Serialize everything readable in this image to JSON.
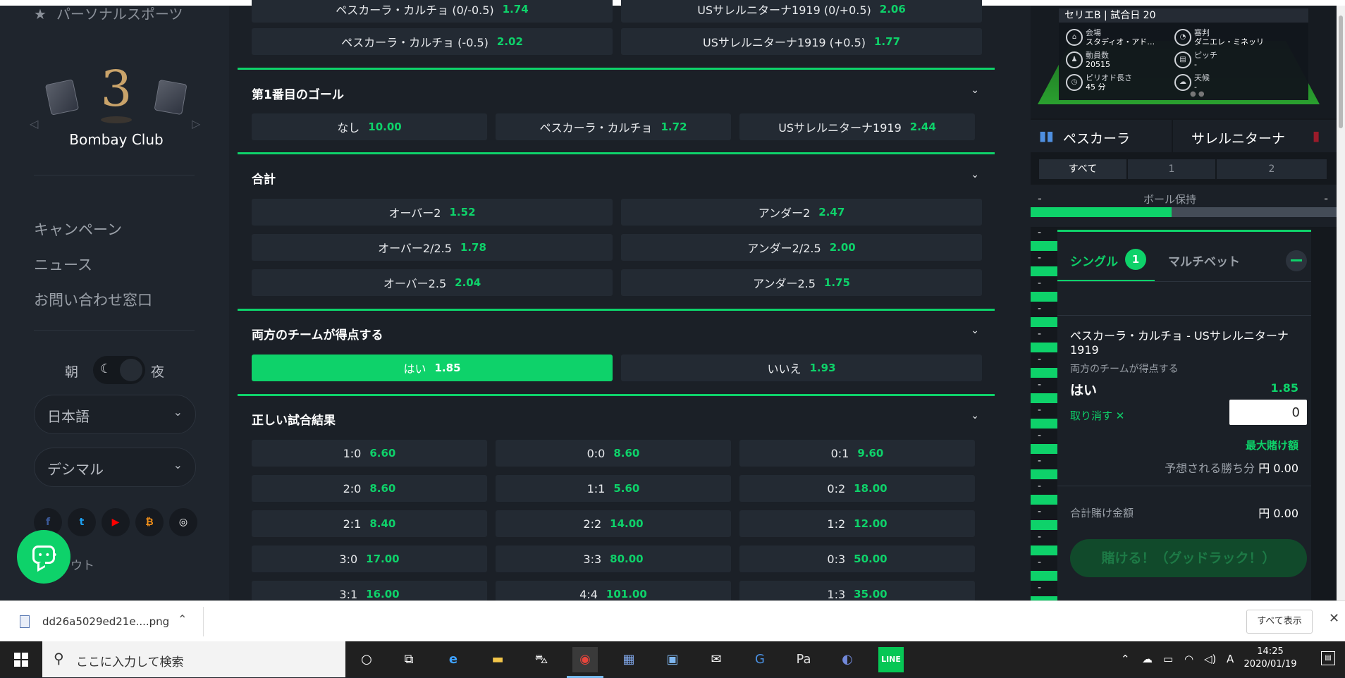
{
  "sidebar": {
    "top_item": "パーソナルスポーツ",
    "casino_name": "Bombay Club",
    "links": [
      "キャンペーン",
      "ニュース",
      "お問い合わせ窓口"
    ],
    "theme_day": "朝",
    "theme_night": "夜",
    "language": "日本語",
    "odds_format": "デシマル",
    "logout": "ウト"
  },
  "main": {
    "row0": [
      {
        "label": "ペスカーラ・カルチョ (0/-0.5)",
        "odd": "1.74"
      },
      {
        "label": "USサレルニターナ1919 (0/+0.5)",
        "odd": "2.06"
      }
    ],
    "row1": [
      {
        "label": "ペスカーラ・カルチョ (-0.5)",
        "odd": "2.02"
      },
      {
        "label": "USサレルニターナ1919 (+0.5)",
        "odd": "1.77"
      }
    ],
    "first_goal": {
      "title": "第1番目のゴール",
      "options": [
        {
          "label": "なし",
          "odd": "10.00"
        },
        {
          "label": "ペスカーラ・カルチョ",
          "odd": "1.72"
        },
        {
          "label": "USサレルニターナ1919",
          "odd": "2.44"
        }
      ]
    },
    "total": {
      "title": "合計",
      "rows": [
        [
          {
            "label": "オーバー2",
            "odd": "1.52"
          },
          {
            "label": "アンダー2",
            "odd": "2.47"
          }
        ],
        [
          {
            "label": "オーバー2/2.5",
            "odd": "1.78"
          },
          {
            "label": "アンダー2/2.5",
            "odd": "2.00"
          }
        ],
        [
          {
            "label": "オーバー2.5",
            "odd": "2.04"
          },
          {
            "label": "アンダー2.5",
            "odd": "1.75"
          }
        ]
      ]
    },
    "btts": {
      "title": "両方のチームが得点する",
      "options": [
        {
          "label": "はい",
          "odd": "1.85"
        },
        {
          "label": "いいえ",
          "odd": "1.93"
        }
      ]
    },
    "correct_score": {
      "title": "正しい試合結果",
      "rows": [
        [
          {
            "label": "1:0",
            "odd": "6.60"
          },
          {
            "label": "0:0",
            "odd": "8.60"
          },
          {
            "label": "0:1",
            "odd": "9.60"
          }
        ],
        [
          {
            "label": "2:0",
            "odd": "8.60"
          },
          {
            "label": "1:1",
            "odd": "5.60"
          },
          {
            "label": "0:2",
            "odd": "18.00"
          }
        ],
        [
          {
            "label": "2:1",
            "odd": "8.40"
          },
          {
            "label": "2:2",
            "odd": "14.00"
          },
          {
            "label": "1:2",
            "odd": "12.00"
          }
        ],
        [
          {
            "label": "3:0",
            "odd": "17.00"
          },
          {
            "label": "3:3",
            "odd": "80.00"
          },
          {
            "label": "0:3",
            "odd": "50.00"
          }
        ],
        [
          {
            "label": "3:1",
            "odd": "16.00"
          },
          {
            "label": "4:4",
            "odd": "101.00"
          },
          {
            "label": "1:3",
            "odd": "35.00"
          }
        ]
      ]
    }
  },
  "match_info": {
    "header": "セリエB | 試合日 20",
    "venue_label": "会場",
    "venue": "スタディオ・アド…",
    "referee_label": "審判",
    "referee": "ダニエレ・ミネッリ",
    "attendance_label": "動員数",
    "attendance": "20515",
    "pitch_label": "ピッチ",
    "pitch": "-",
    "period_label": "ピリオド長さ",
    "period": "45 分",
    "weather_label": "天候",
    "weather": "-",
    "home": "ペスカーラ",
    "away": "サレルニターナ",
    "periods": [
      "すべて",
      "1",
      "2"
    ],
    "possession_label": "ボール保持",
    "possession_left": "-",
    "possession_right": "-",
    "possession_home_fraction": 0.46
  },
  "betslip": {
    "tab_single": "シングル",
    "single_count": "1",
    "tab_multi": "マルチベット",
    "match": "ペスカーラ・カルチョ - USサレルニターナ1919",
    "market": "両方のチームが得点する",
    "selection": "はい",
    "selection_odd": "1.85",
    "remove": "取り消す ✕",
    "stake": "0",
    "max_bet": "最大賭け額",
    "potential_win_label": "予想される勝ち分",
    "potential_win_value": "円 0.00",
    "total_stake_label": "合計賭け金額",
    "total_stake_value": "円  0.00",
    "submit": "賭ける！（グッドラック！）"
  },
  "download_bar": {
    "file": "dd26a5029ed21e....png",
    "show_all": "すべて表示"
  },
  "taskbar": {
    "search_placeholder": "ここに入力して検索",
    "ime": "A",
    "time": "14:25",
    "date": "2020/01/19"
  },
  "colors": {
    "accent": "#0ed26a",
    "background": "#1b2027",
    "panel": "#232a33"
  }
}
